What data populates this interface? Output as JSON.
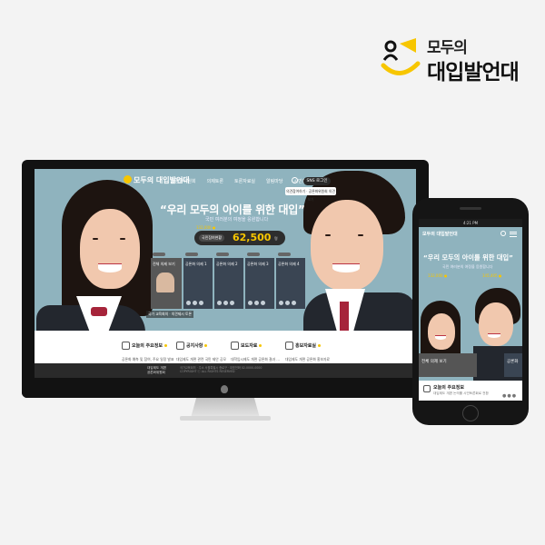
{
  "brand": {
    "line1": "모두의",
    "line2": "대입발언대"
  },
  "desktop": {
    "logo": "모두의\n대입발언대",
    "nav": [
      "공론화위원회",
      "의제토론",
      "토론자료실",
      "알림마당",
      "시민참여단"
    ],
    "sns_button": "SNS 로그인",
    "tooltip": "의견참여하기 · 공론화위원회 의견보기",
    "hero_title": "“우리 모두의 아이를 위한 대입”",
    "hero_sub": "국민 여러분의 여정을 응원합니다",
    "small_amount": "132,000 ●",
    "amount_label": "국민참여현황",
    "amount_value": "62,500",
    "amount_unit": "명",
    "cards": [
      "전체 의제 보기",
      "공론화 의제 1",
      "공론화 의제 2",
      "공론화 의제 3",
      "공론화 의제 4"
    ],
    "caption": "국가 교육회의 · 의견제시 토론",
    "info": [
      {
        "title": "오늘의 주요정보",
        "line": "공론화 예측 및 참여, 주요 일정 발표",
        "date": "2018.05.15"
      },
      {
        "title": "공지사항",
        "line": "대입제도 개편 관련 국민 제안 공모",
        "date": "2018.05.14"
      },
      {
        "title": "보도자료",
        "line": "대학입시제도 개편 공론화 결과 …",
        "date": "2018.05.13"
      },
      {
        "title": "홍보자료실",
        "line": "대입제도 개편 공론화 홍보자료",
        "date": "2018.05.12"
      }
    ],
    "footer_left": "대입제도 개편\n공론화위원회",
    "footer_right": "국가교육회의 · 주소 서울특별시 종로구 · 대표전화 02-0000-0000\nCOPYRIGHT ⓒ ALL RIGHTS RESERVED"
  },
  "phone": {
    "status_time": "4:21 PM",
    "logo": "모두의 대입발언대",
    "hero_title": "“우리 모두의 아이를 위한 대입”",
    "hero_sub": "국민 여러분의 여정을 응원합니다",
    "amount_left": "132,000 ●",
    "amount_right": "145,405 ●",
    "card_left": "전체 의제 보기",
    "card_right": "공론화",
    "info_title": "오늘의 주요정보",
    "info_line": "대입제도 개편 논의를 시민토론회로 전환",
    "dots": "●●●"
  },
  "colors": {
    "accent": "#f7c600",
    "hero_bg": "#8fb3be",
    "dark": "#2a2a2a"
  }
}
